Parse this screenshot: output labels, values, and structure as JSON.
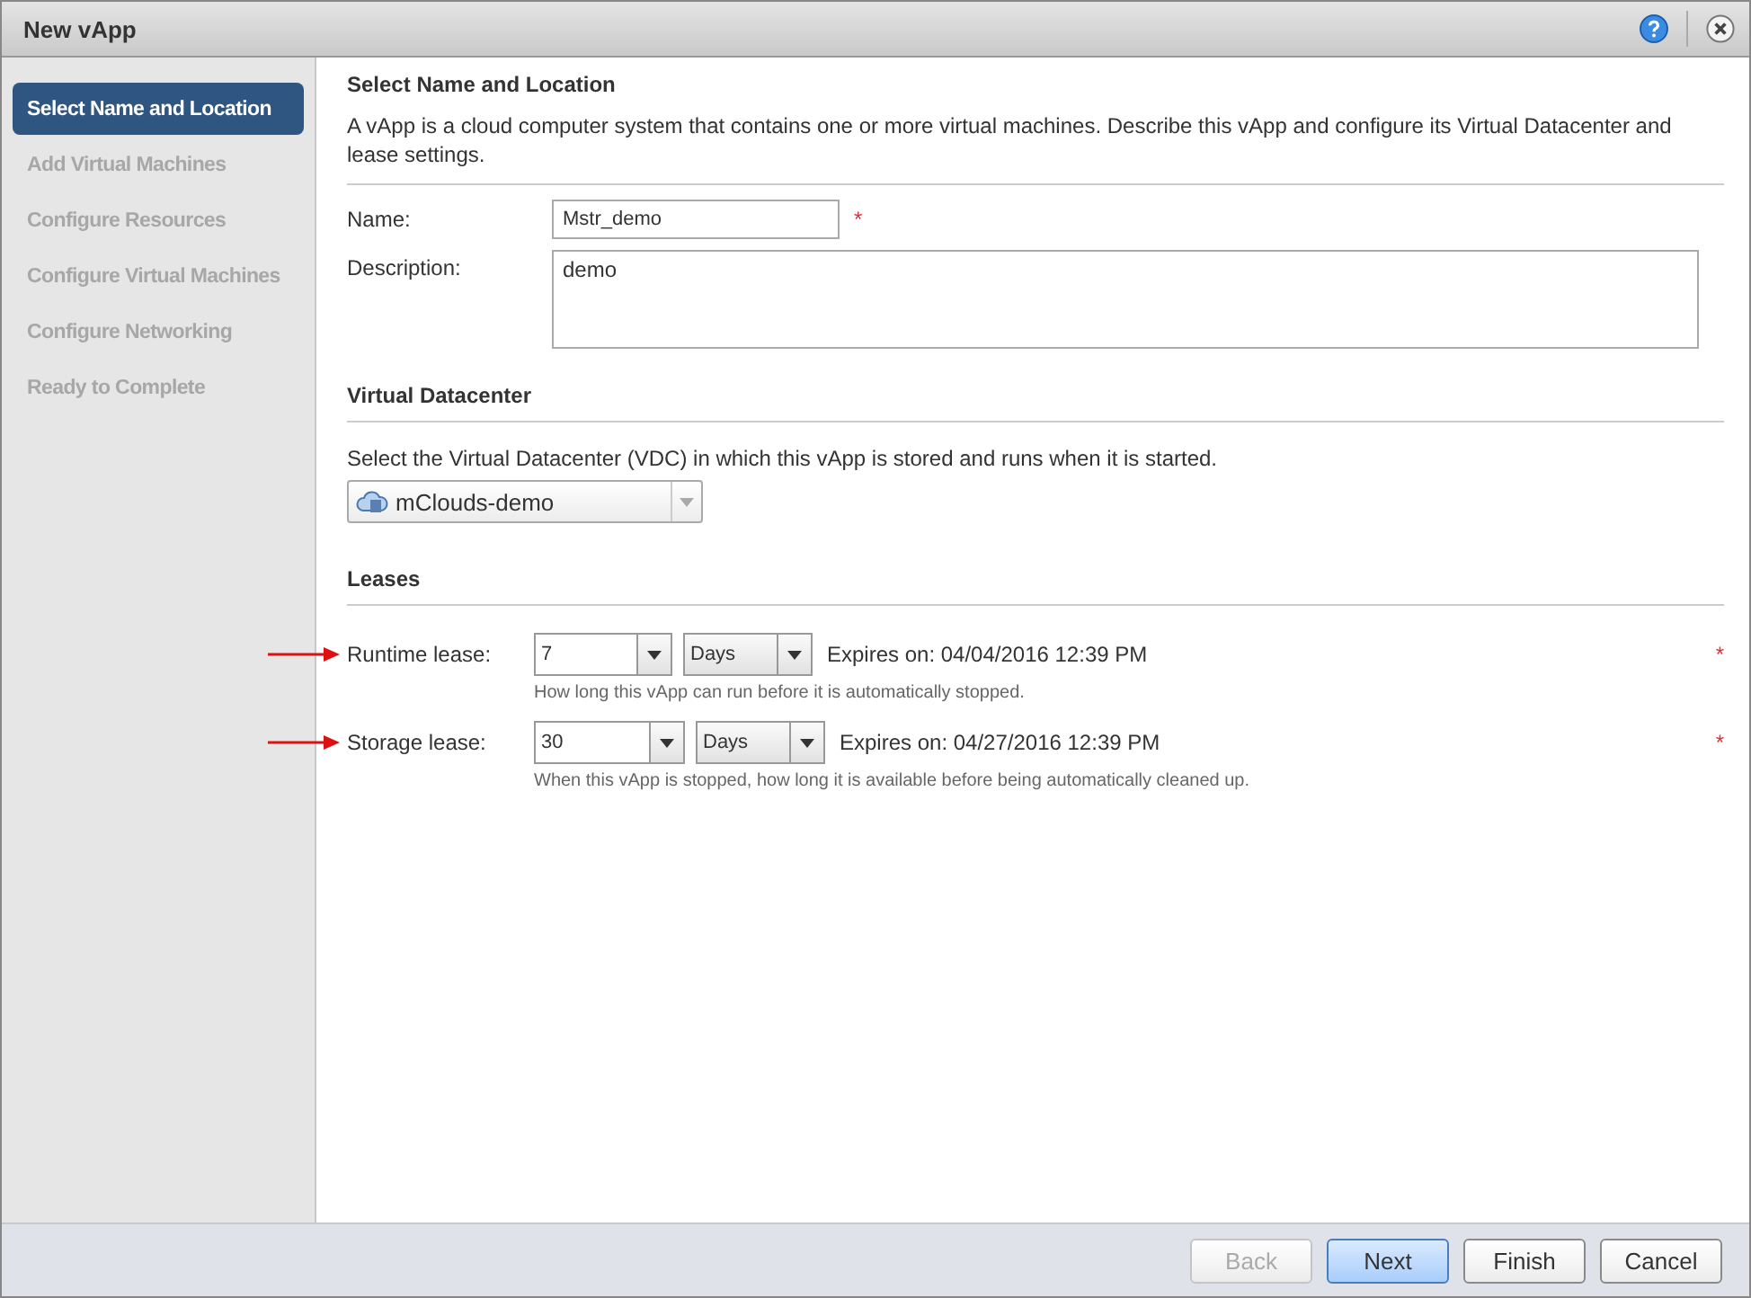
{
  "window": {
    "title": "New vApp"
  },
  "steps": [
    {
      "label": "Select Name and Location",
      "selected": true
    },
    {
      "label": "Add Virtual Machines",
      "selected": false
    },
    {
      "label": "Configure Resources",
      "selected": false
    },
    {
      "label": "Configure Virtual Machines",
      "selected": false
    },
    {
      "label": "Configure Networking",
      "selected": false
    },
    {
      "label": "Ready to Complete",
      "selected": false
    }
  ],
  "intro": {
    "heading": "Select Name and Location",
    "text": "A vApp is a cloud computer system that contains one or more virtual machines. Describe this vApp and configure its Virtual Datacenter and lease settings."
  },
  "name_field": {
    "label": "Name:",
    "value": "Mstr_demo",
    "required_mark": "*"
  },
  "description_field": {
    "label": "Description:",
    "value": "demo"
  },
  "datacenter": {
    "heading": "Virtual Datacenter",
    "text": "Select the Virtual Datacenter (VDC) in which this vApp is stored and runs when it is started.",
    "selection": "mClouds-demo"
  },
  "leases": {
    "heading": "Leases",
    "rows": [
      {
        "label": "Runtime lease:",
        "value": "7",
        "unit": "Days",
        "expires": "Expires on: 04/04/2016 12:39 PM",
        "hint": "How long this vApp can run before it is automatically stopped.",
        "required_mark": "*",
        "annotated": true
      },
      {
        "label": "Storage lease:",
        "value": "30",
        "unit": "Days",
        "expires": "Expires on: 04/27/2016 12:39 PM",
        "hint": "When this vApp is stopped, how long it is available before being automatically cleaned up.",
        "required_mark": "*",
        "annotated": true
      }
    ]
  },
  "buttons": [
    {
      "label": "Back",
      "disabled": true,
      "primary": false
    },
    {
      "label": "Next",
      "disabled": false,
      "primary": true
    },
    {
      "label": "Finish",
      "disabled": false,
      "primary": false
    },
    {
      "label": "Cancel",
      "disabled": false,
      "primary": false
    }
  ]
}
